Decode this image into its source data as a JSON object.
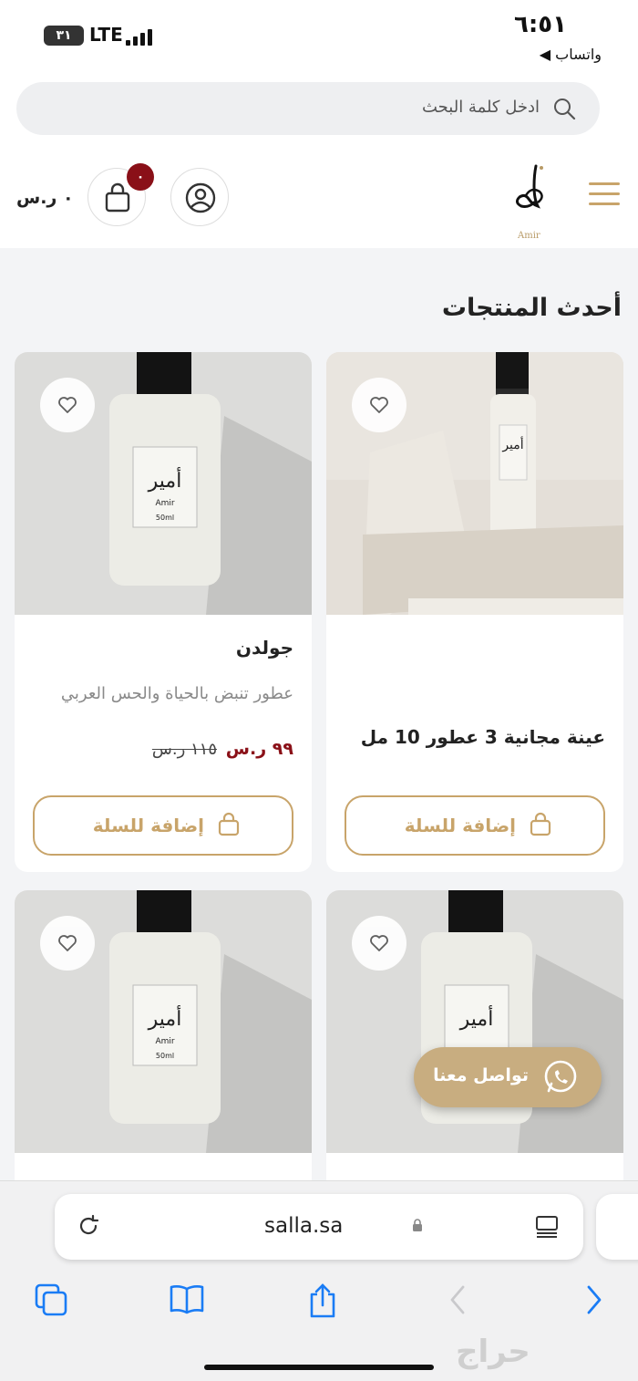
{
  "status_bar": {
    "time": "٦:٥١",
    "back_label": "◀ واتساب",
    "battery": "٣١",
    "network": "LTE"
  },
  "search": {
    "placeholder": "ادخل كلمة البحث",
    "icon": "search-icon"
  },
  "header": {
    "logo_text": "Amir",
    "cart_badge": "٠",
    "cart_total": "٠ ر.س"
  },
  "section": {
    "title": "أحدث المنتجات"
  },
  "products": [
    {
      "title": "عينة مجانية 3 عطور 10 مل",
      "add_label": "إضافة للسلة"
    },
    {
      "title": "جولدن",
      "description": "عطور تنبض بالحياة والحس العربي",
      "price": "٩٩ ر.س",
      "old_price": "١١٥ ر.س",
      "add_label": "إضافة للسلة"
    }
  ],
  "whatsapp": {
    "label": "تواصل معنا"
  },
  "browser": {
    "host": "salla.sa"
  },
  "watermark": "حراج",
  "colors": {
    "accent": "#c8a46a",
    "price": "#8a1018",
    "badge": "#8a1018"
  }
}
